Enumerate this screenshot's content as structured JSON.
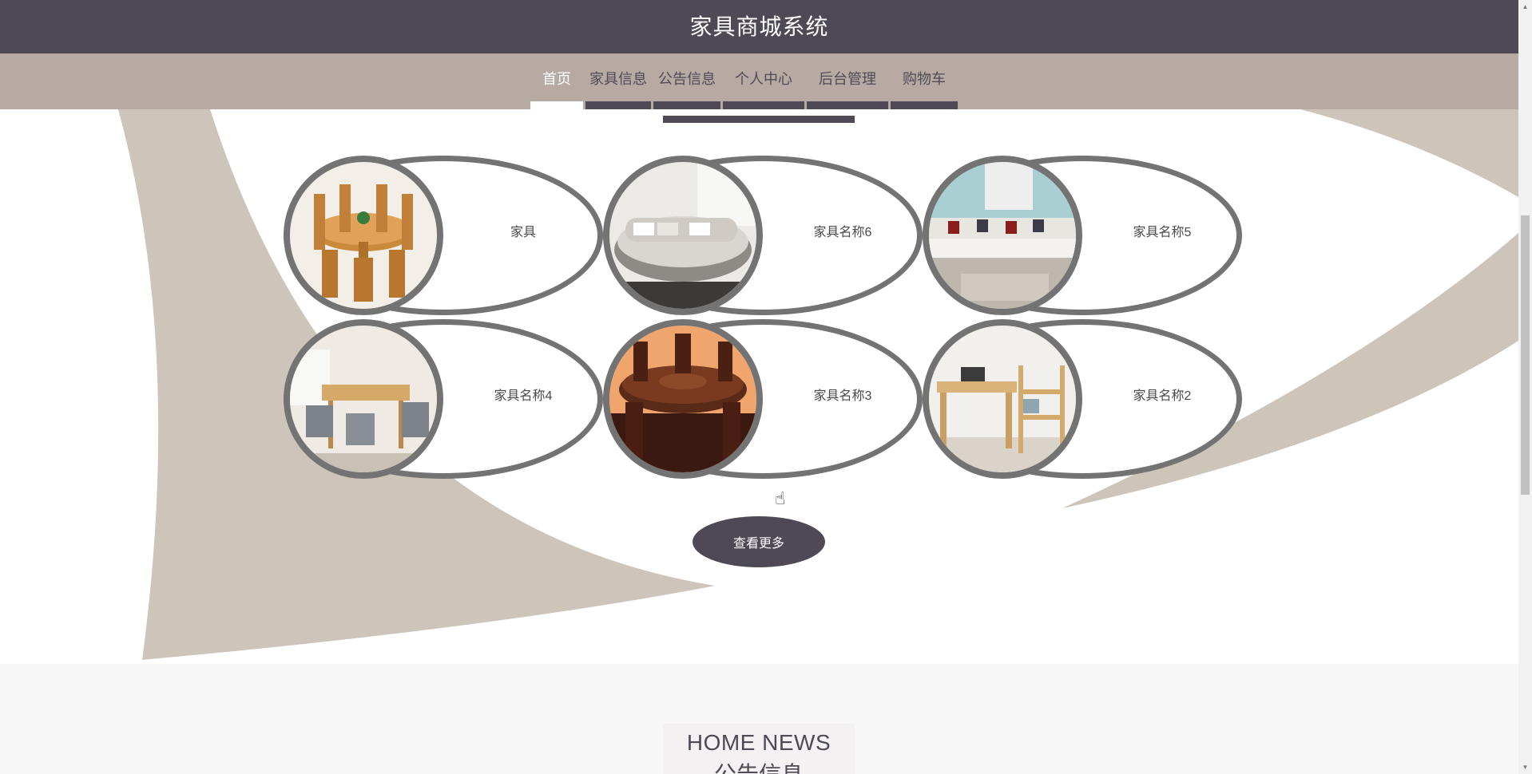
{
  "header": {
    "title": "家具商城系统"
  },
  "nav": {
    "items": [
      {
        "label": "首页",
        "active": true
      },
      {
        "label": "家具信息",
        "active": false
      },
      {
        "label": "公告信息",
        "active": false
      },
      {
        "label": "个人中心",
        "active": false
      },
      {
        "label": "后台管理",
        "active": false
      },
      {
        "label": "购物车",
        "active": false
      }
    ]
  },
  "furniture": {
    "items": [
      {
        "name": "家具",
        "image_icon": "round-dining-table-photo"
      },
      {
        "name": "家具名称6",
        "image_icon": "round-bed-photo"
      },
      {
        "name": "家具名称5",
        "image_icon": "sectional-sofa-photo"
      },
      {
        "name": "家具名称4",
        "image_icon": "dining-set-photo"
      },
      {
        "name": "家具名称3",
        "image_icon": "mahogany-table-photo"
      },
      {
        "name": "家具名称2",
        "image_icon": "desk-shelf-photo"
      }
    ],
    "more_label": "查看更多"
  },
  "news": {
    "title_en": "HOME NEWS",
    "title_cn": "公告信息"
  },
  "colors": {
    "header_bg": "#4e4955",
    "nav_bg": "#b6aaa2",
    "accent_shape": "#cdc4ba",
    "card_border": "#737373"
  }
}
